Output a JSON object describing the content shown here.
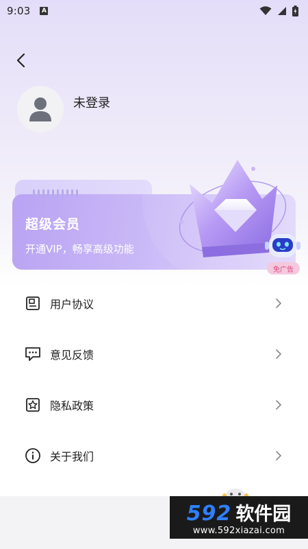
{
  "status_bar": {
    "time": "9:03",
    "notification_icon_label": "A",
    "icons": [
      "wifi-icon",
      "signal-icon",
      "battery-icon"
    ]
  },
  "header": {
    "back_icon": "chevron-left-icon"
  },
  "profile": {
    "login_text": "未登录",
    "avatar_icon": "user-icon"
  },
  "vip_card": {
    "title": "超级会员",
    "subtitle": "开通VIP，畅享高级功能",
    "badge": "免广告",
    "crown_icon": "crown-diamond-icon",
    "robot_icon": "robot-icon"
  },
  "menu": [
    {
      "label": "用户协议",
      "icon": "document-icon"
    },
    {
      "label": "意见反馈",
      "icon": "feedback-icon"
    },
    {
      "label": "隐私政策",
      "icon": "star-shield-icon"
    },
    {
      "label": "关于我们",
      "icon": "info-icon"
    }
  ],
  "watermark": {
    "number": "592",
    "text": "软件园",
    "url": "www.592xiazai.com"
  },
  "colors": {
    "vip_gradient_start": "#b9a3f3",
    "vip_gradient_end": "#e2d9fb",
    "badge_bg": "#f4c9de",
    "badge_text": "#e0457e",
    "watermark_blue": "#2f7fff"
  }
}
